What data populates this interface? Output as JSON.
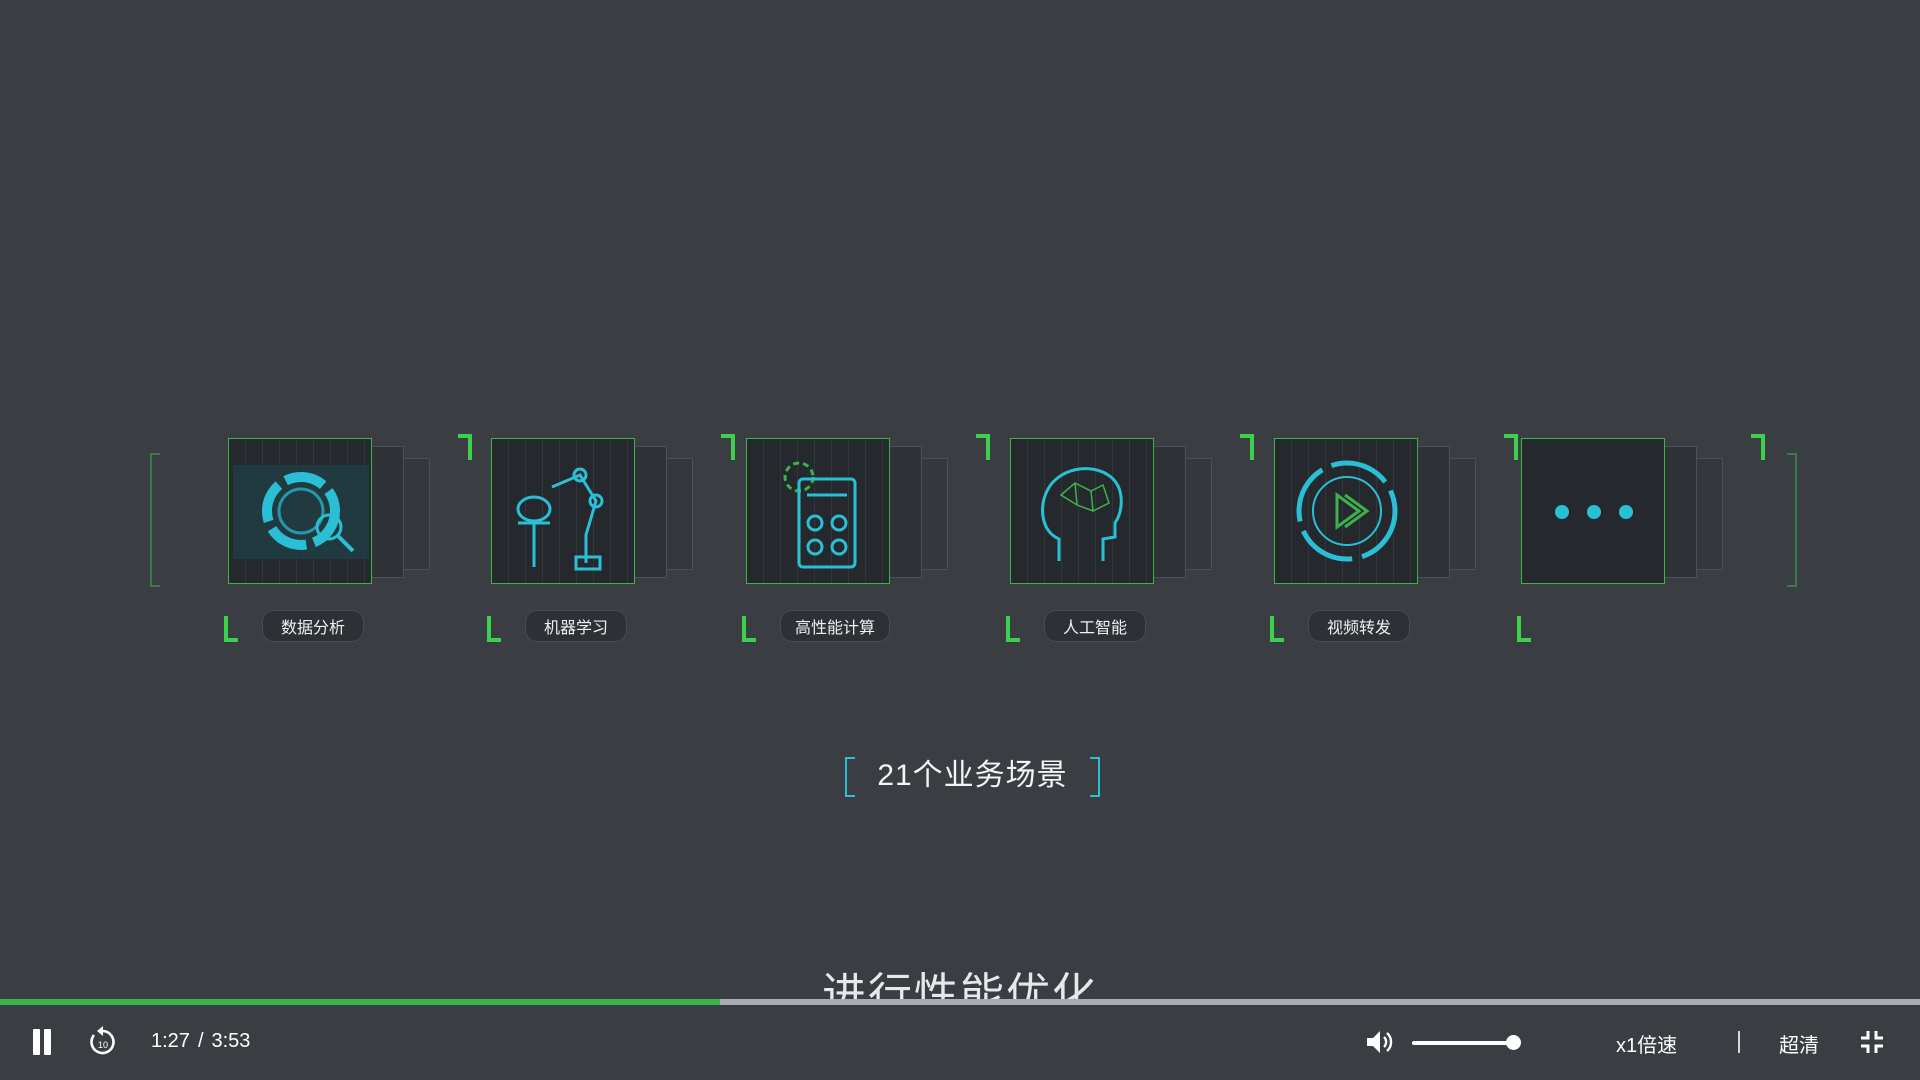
{
  "scenarios": [
    {
      "label": "数据分析",
      "icon": "data-analysis-icon"
    },
    {
      "label": "机器学习",
      "icon": "robot-arm-icon"
    },
    {
      "label": "高性能计算",
      "icon": "calculator-icon"
    },
    {
      "label": "人工智能",
      "icon": "ai-brain-icon"
    },
    {
      "label": "视频转发",
      "icon": "video-play-icon"
    },
    {
      "label": "",
      "icon": "more-dots-icon"
    }
  ],
  "scene_title": "21个业务场景",
  "subtitle": "进行性能优化",
  "player": {
    "current_time": "1:27",
    "separator": "/",
    "duration": "3:53",
    "progress": 0.375,
    "volume": 0.9,
    "speed_label": "x1倍速",
    "quality_label": "超清",
    "accent_color": "#3bb34a",
    "icons": [
      "pause-icon",
      "replay-10-icon",
      "volume-icon",
      "fullscreen-exit-icon"
    ]
  }
}
